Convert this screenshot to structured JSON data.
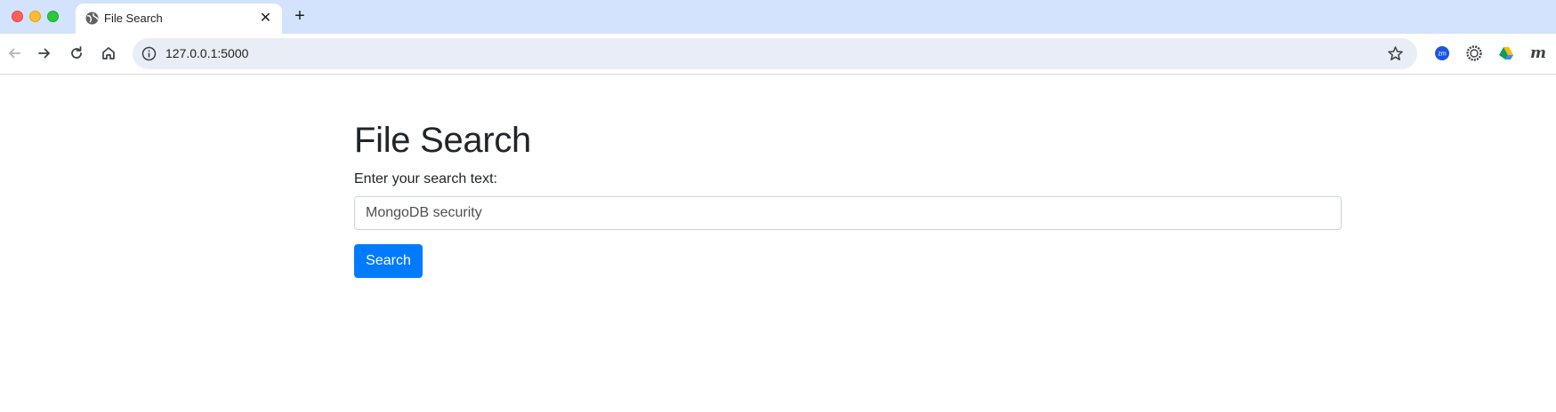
{
  "browser": {
    "tab": {
      "title": "File Search",
      "favicon": "globe-icon",
      "close": "✕"
    },
    "new_tab": "+",
    "toolbar": {
      "back": "arrow-left-icon",
      "forward": "arrow-right-icon",
      "reload": "reload-icon",
      "home": "home-icon"
    },
    "omnibox": {
      "url": "127.0.0.1:5000",
      "info": "info-icon",
      "bookmark": "star-icon"
    },
    "extensions": [
      "zm-extension-icon",
      "gear-extension-icon",
      "google-drive-icon",
      "m-extension-icon"
    ],
    "extension_labels": {
      "zm": "zm",
      "m": "m"
    }
  },
  "page": {
    "title": "File Search",
    "label": "Enter your search text:",
    "search_value": "MongoDB security",
    "button_label": "Search",
    "accent_color": "#007bff"
  }
}
